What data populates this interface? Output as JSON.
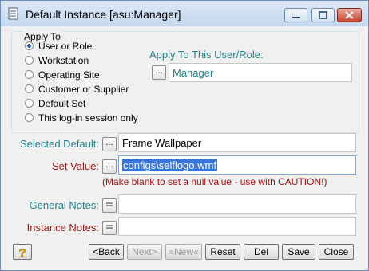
{
  "window": {
    "title": "Default Instance [asu:Manager]"
  },
  "apply_to": {
    "group_label": "Apply To",
    "options": [
      {
        "label": "User or Role",
        "checked": true
      },
      {
        "label": "Workstation",
        "checked": false
      },
      {
        "label": "Operating Site",
        "checked": false
      },
      {
        "label": "Customer or Supplier",
        "checked": false
      },
      {
        "label": "Default Set",
        "checked": false
      },
      {
        "label": "This log-in session only",
        "checked": false
      }
    ],
    "target_label": "Apply To This User/Role:",
    "target_button": "...",
    "target_value": "Manager"
  },
  "fields": {
    "selected_default_label": "Selected Default:",
    "selected_default_button": "...",
    "selected_default_value": "Frame Wallpaper",
    "set_value_label": "Set Value:",
    "set_value_button": "...",
    "set_value_value": "configs\\selflogo.wmf",
    "warning": "(Make blank to set a null value - use with CAUTION!)",
    "general_notes_label": "General Notes:",
    "general_notes_value": "",
    "instance_notes_label": "Instance Notes:",
    "instance_notes_value": ""
  },
  "buttons": {
    "back": "<Back",
    "next": "Next>",
    "new": "»New«",
    "reset": "Reset",
    "del": "Del",
    "save": "Save",
    "close": "Close"
  },
  "icons": {
    "window": "document-icon",
    "help": "help-icon",
    "notes": "notes-icon"
  }
}
